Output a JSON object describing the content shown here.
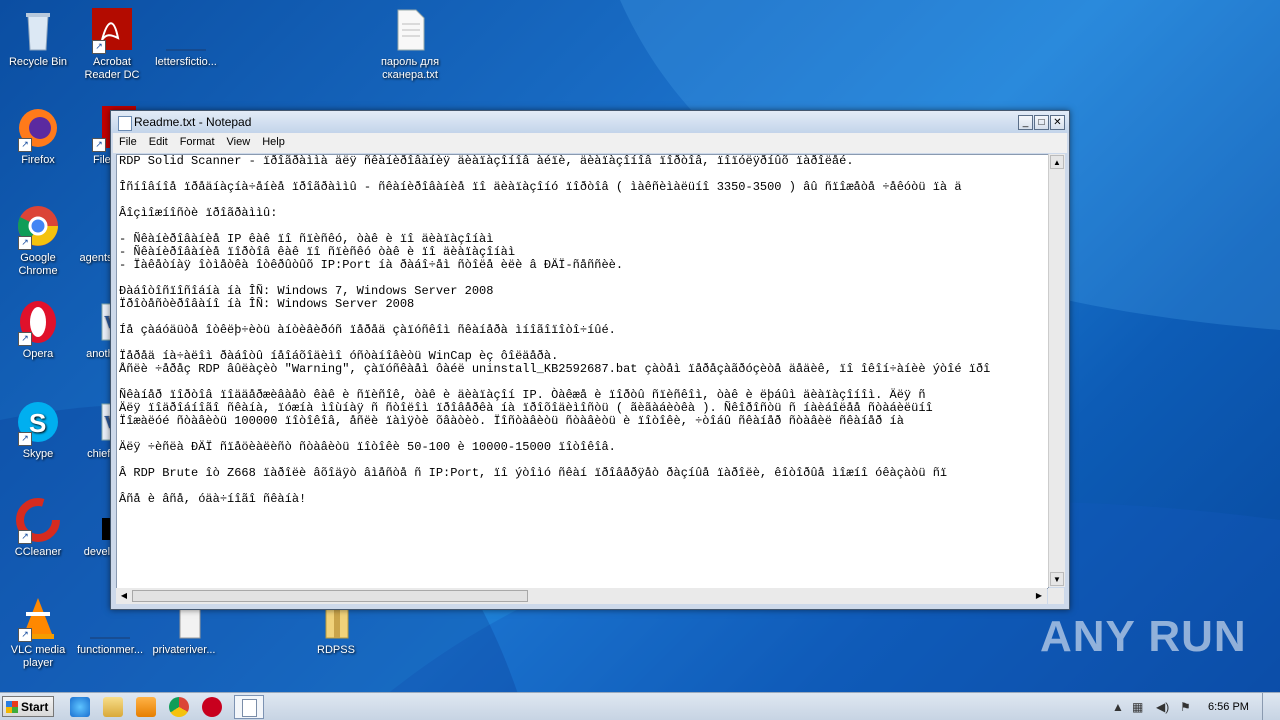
{
  "desktop": {
    "icons": [
      {
        "label": "Recycle Bin"
      },
      {
        "label": "Acrobat Reader DC"
      },
      {
        "label": "lettersfictio..."
      },
      {
        "label": "пароль для сканера.txt"
      },
      {
        "label": "Firefox"
      },
      {
        "label": "FileZilla"
      },
      {
        "label": "Google Chrome"
      },
      {
        "label": "agents"
      },
      {
        "label": "Opera"
      },
      {
        "label": "anothe"
      },
      {
        "label": "Skype"
      },
      {
        "label": "chiefgi"
      },
      {
        "label": "CCleaner"
      },
      {
        "label": "develop"
      },
      {
        "label": "VLC media player"
      },
      {
        "label": "functionmer..."
      },
      {
        "label": "privateriver..."
      },
      {
        "label": "RDPSS"
      }
    ]
  },
  "notepad": {
    "title": "Readme.txt - Notepad",
    "menu": [
      "File",
      "Edit",
      "Format",
      "View",
      "Help"
    ],
    "window_buttons": {
      "minimize": "_",
      "maximize": "□",
      "close": "✕"
    },
    "text_lines": [
      "RDP Solid Scanner - ïðîãðàììà äëÿ ñêàíèðîâàíèÿ äèàïàçîíîâ àéïè, äèàïàçîíîâ ïîðòîâ, ïîïóëÿðíûõ ïàðîëåé.",
      "",
      "Îñíîâíîå ïðåäíàçíà÷åíèå ïðîãðàììû - ñêàíèðîâàíèå ïî äèàïàçîíó ïîðòîâ ( ìàêñèìàëüíî 3350-3500 ) âû ñïîæåòå ÷åêóòü ïà ä",
      "",
      "Âîçìîæíîñòè ïðîãðàììû:",
      "",
      "- Ñêàíèðîâàíèå IP êàê ïî ñïèñêó, òàê è ïî äèàïàçîíàì",
      "- Ñêàíèðîâàíèå ïîðòîâ êàê ïî ñïèñêó òàê è ïî äèàïàçîíàì",
      "- Ïàêåòíàÿ îòìåòêà îòêðûòûõ IP:Port íà ðàáî÷åì ñòîëå èëè â ÐÄÏ-ñåññèè.",
      "",
      "Ðàáîòîñïîñîáíà íà ÎÑ: Windows 7, Windows Server 2008",
      "Ïðîòåñòèðîâàíî íà ÎÑ: Windows Server 2008",
      "",
      "Íå çàáóäüòå îòêëþ÷èòü àíòèâèðóñ ïåðåä çàïóñêîì ñêàíåðà ìíîãîïîòî÷íûé.",
      "",
      "Ïåðåä íà÷àëîì ðàáîòû íåîáõîäèìî óñòàíîâèòü WinCap èç ôîëäåðà.",
      "Åñëè ÷åðåç RDP âûëàçèò \"Warning\", çàïóñêàåì ôàéë uninstall_KB2592687.bat çàòåì ïåðåçàãðóçèòå äåäèê, ïî îêîí÷àíèè ýòîé ïðî",
      "",
      "Ñêàíåð ïîðòîâ ïîääåðæèâàåò êàê è ñïèñîê, òàê è äèàïàçîí IP. Òàêæå è ïîðòû ñïèñêîì, òàê è ëþáûì äèàïàçîíîì. Äëÿ ñ",
      "Äëÿ ïîäðîáíîãî ñêàíà, ïóæíà ìîùíàÿ ñ ñòîëîì ïðîâåðêà íà ïðîõîäèìîñòü ( ãèãàáèòêà ). Ñêîðîñòü ñ íàèáîëåå ñòàáèëüíî",
      "Ïîæàëóé ñòàâèòü 100000 ïîòîêîâ, åñëè ïàìÿòè õâàòèò. Ïîñòàâèòü ñòàâèòü è ïîòîêè, ÷òîáû ñêàíåð ñòàâèë ñêàíåð íà",
      "",
      "Äëÿ ÷èñëà ÐÄÏ ñïåöèàëèñò ñòàâèòü ïîòîêè 50-100 è 10000-15000 ïîòîêîâ.",
      "",
      "Â RDP Brute îò Z668 ïàðîëè âõîäÿò âìåñòå ñ IP:Port, ïî ýòîìó ñêàí ïðîâåðÿåò ðàçíûå ïàðîëè, êîòîðûå ìîæíî óêàçàòü ñï",
      "",
      "Âñå è âñå, óäà÷íîãî ñêàíà!"
    ]
  },
  "taskbar": {
    "start_label": "Start",
    "clock": "6:56 PM"
  },
  "watermark": "ANY RUN"
}
